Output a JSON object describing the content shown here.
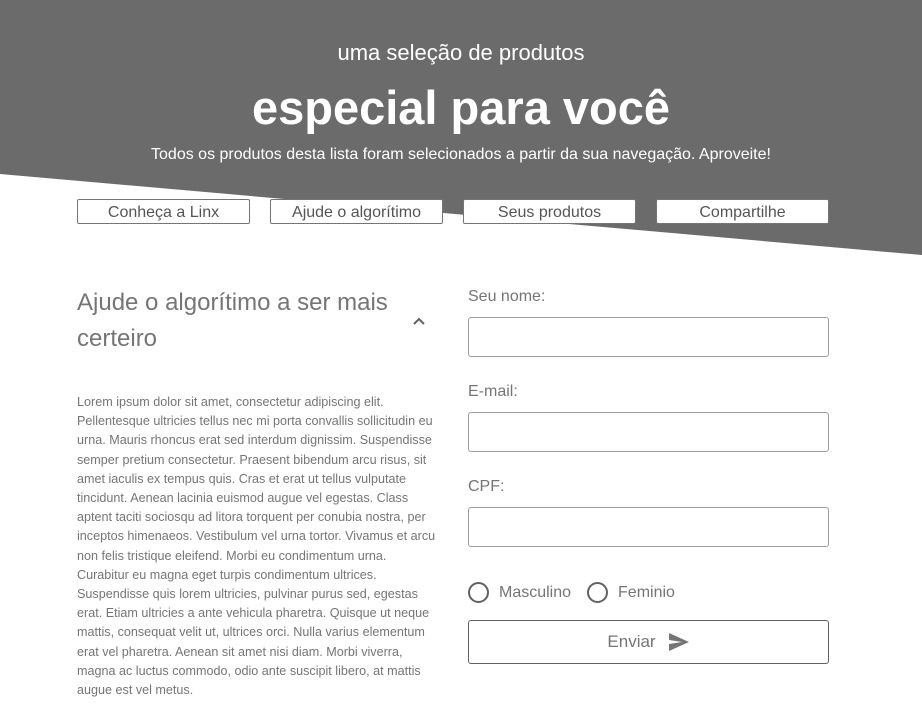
{
  "colors": {
    "hero_bg": "#6b6b6b",
    "text": "#757575",
    "border": "#9e9e9e",
    "white": "#ffffff"
  },
  "hero": {
    "subtitle": "uma seleção de produtos",
    "title": "especial para você",
    "description": "Todos os produtos desta lista foram selecionados a partir da sua navegação. Aproveite!"
  },
  "nav": {
    "items": [
      {
        "label": "Conheça a Linx"
      },
      {
        "label": "Ajude o algorítimo"
      },
      {
        "label": "Seus produtos"
      },
      {
        "label": "Compartilhe"
      }
    ]
  },
  "accordion": {
    "title": "Ajude o algorítimo a ser mais certeiro",
    "icon": "chevron-up-icon",
    "expanded": true,
    "body": "Lorem ipsum dolor sit amet, consectetur adipiscing elit. Pellentesque ultricies tellus nec mi porta convallis sollicitudin eu urna. Mauris rhoncus erat sed interdum dignissim. Suspendisse semper pretium consectetur. Praesent bibendum arcu risus, sit amet iaculis ex tempus quis. Cras et erat ut tellus vulputate tincidunt. Aenean lacinia euismod augue vel egestas. Class aptent taciti sociosqu ad litora torquent per conubia nostra, per inceptos himenaeos. Vestibulum vel urna tortor. Vivamus et arcu non felis tristique eleifend. Morbi eu condimentum urna. Curabitur eu magna eget turpis condimentum ultrices. Suspendisse quis lorem ultricies, pulvinar purus sed, egestas erat. Etiam ultricies a ante vehicula pharetra. Quisque ut neque mattis, consequat velit ut, ultrices orci. Nulla varius elementum erat vel pharetra. Aenean sit amet nisi diam. Morbi viverra, magna ac luctus commodo, odio ante suscipit libero, at mattis augue est vel metus."
  },
  "form": {
    "name_label": "Seu nome:",
    "name_value": "",
    "email_label": "E-mail:",
    "email_value": "",
    "cpf_label": "CPF:",
    "cpf_value": "",
    "gender_options": [
      {
        "label": "Masculino",
        "checked": false
      },
      {
        "label": "Feminio",
        "checked": false
      }
    ],
    "submit_label": "Enviar",
    "submit_icon": "send-icon"
  }
}
